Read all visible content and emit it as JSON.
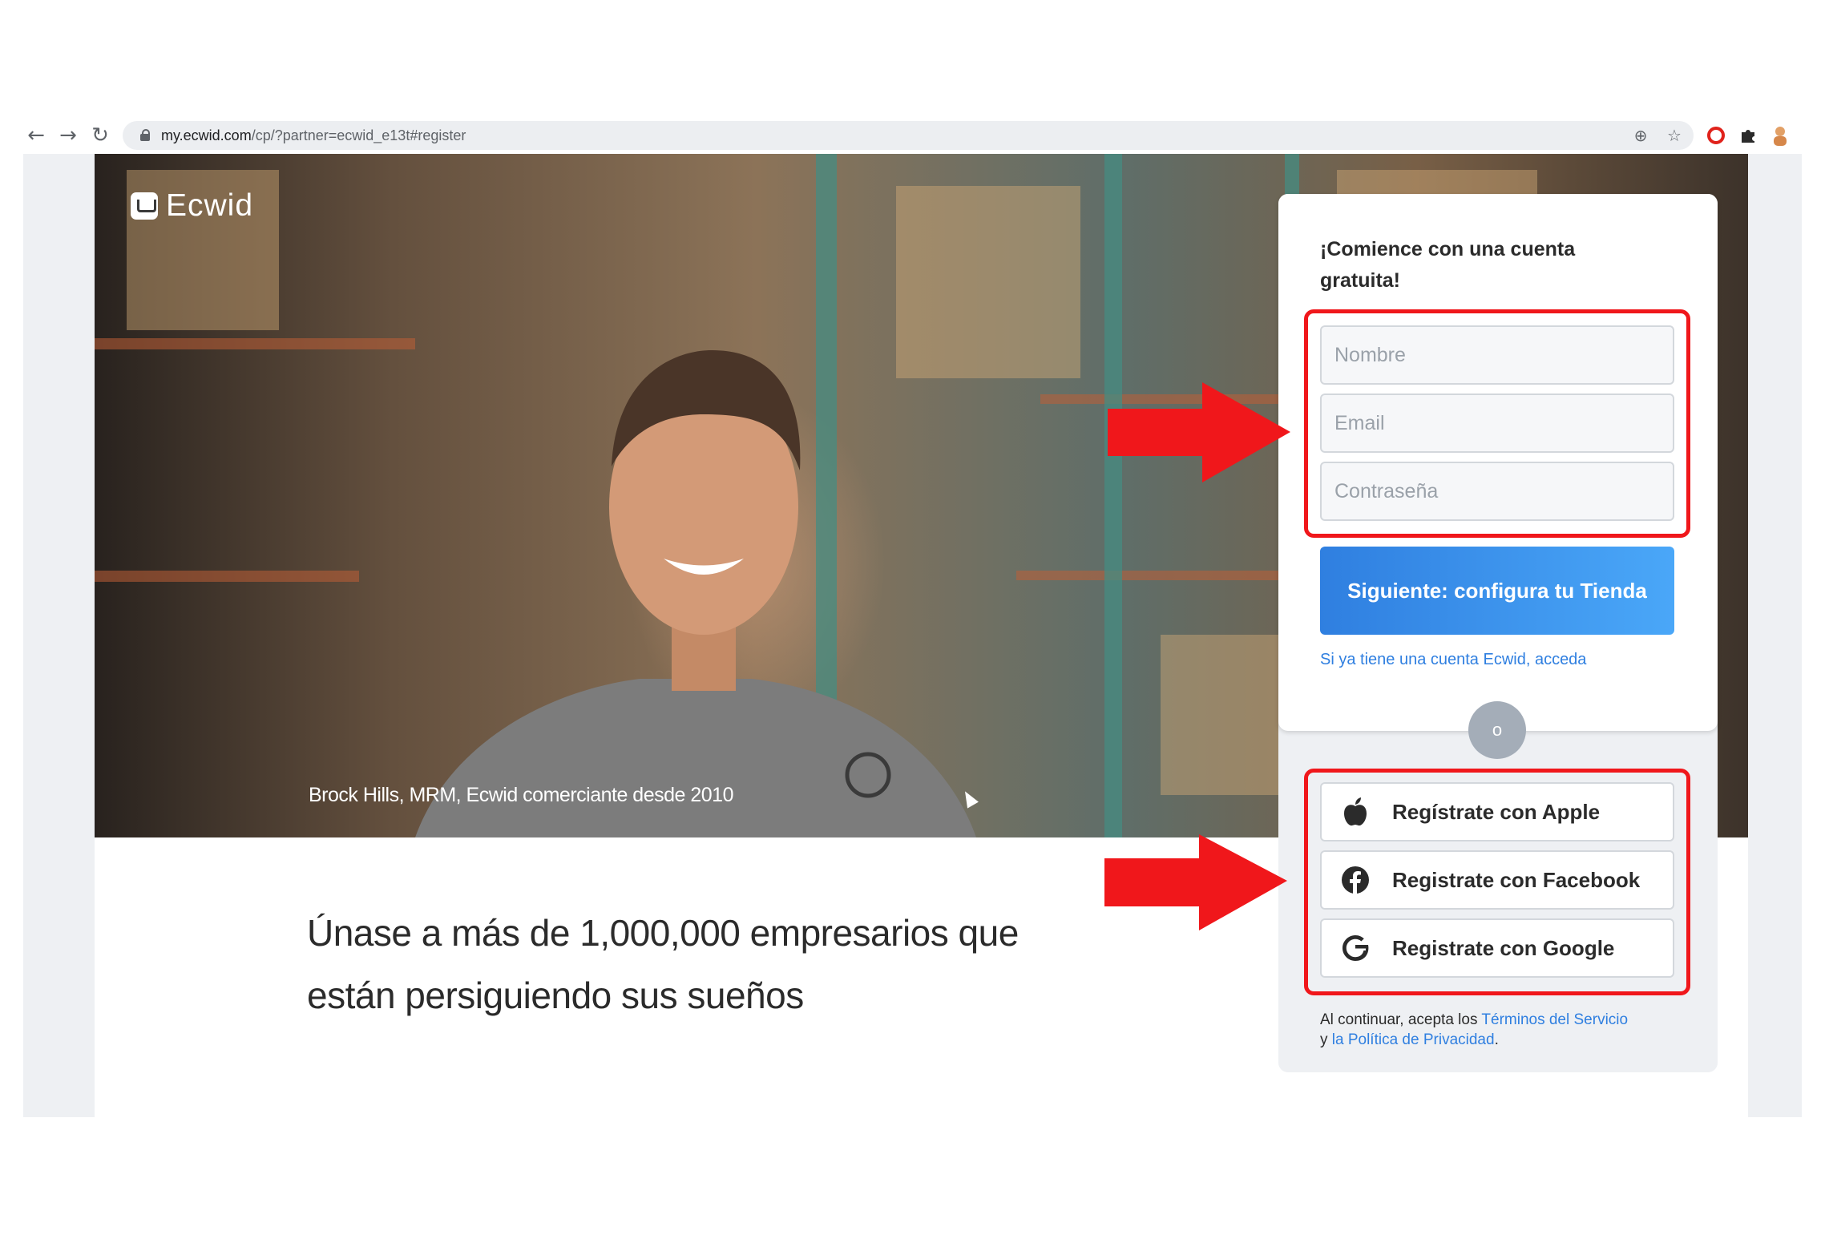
{
  "browser": {
    "url_host": "my.ecwid.com",
    "url_path": "/cp/?partner=ecwid_e13t#register",
    "back_icon": "←",
    "forward_icon": "→",
    "reload_icon": "↻"
  },
  "hero": {
    "logo_text": "Ecwid",
    "caption": "Brock Hills, MRM, Ecwid comerciante desde 2010"
  },
  "tagline": "Únase a más de 1,000,000 empresarios que están persiguiendo sus sueños",
  "signup": {
    "title": "¡Comience con una cuenta gratuita!",
    "name_placeholder": "Nombre",
    "email_placeholder": "Email",
    "password_placeholder": "Contraseña",
    "next_button": "Siguiente: configura tu Tienda",
    "signin_link": "Si ya tiene una cuenta Ecwid, acceda",
    "divider": "o",
    "apple_label": "Regístrate con Apple",
    "facebook_label": "Registrate con Facebook",
    "google_label": "Registrate con Google",
    "legal_prefix": "Al continuar, acepta los ",
    "terms_link": "Términos del Servicio",
    "legal_and": "y ",
    "privacy_link": "la Política de Privacidad",
    "legal_suffix": "."
  },
  "colors": {
    "accent_blue": "#2f7fe0",
    "annotation_red": "#f0171b"
  }
}
